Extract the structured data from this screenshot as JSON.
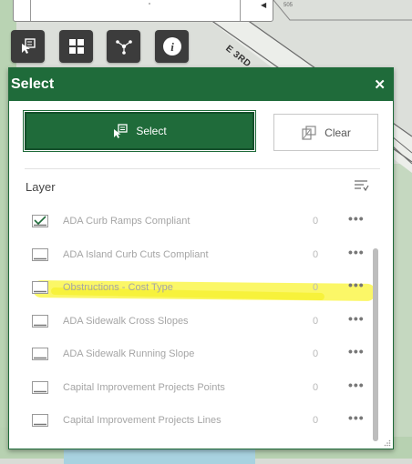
{
  "map": {
    "street_label": "E 3RD",
    "small_label": "505"
  },
  "toolbar": {
    "tools": [
      "select-tool",
      "basemap-gallery",
      "share",
      "info"
    ],
    "info_glyph": "i"
  },
  "panel": {
    "title": "Select",
    "close_label": "✕",
    "select_button_label": "Select",
    "clear_button_label": "Clear",
    "layer_header": "Layer",
    "layers": [
      {
        "name": "ADA Curb Ramps Compliant",
        "count": "0",
        "checked": true,
        "highlighted": true
      },
      {
        "name": "ADA Island Curb Cuts Compliant",
        "count": "0",
        "checked": false
      },
      {
        "name": "Obstructions - Cost Type",
        "count": "0",
        "checked": false
      },
      {
        "name": "ADA Sidewalk Cross Slopes",
        "count": "0",
        "checked": false
      },
      {
        "name": "ADA Sidewalk Running Slope",
        "count": "0",
        "checked": false
      },
      {
        "name": "Capital Improvement Projects Points",
        "count": "0",
        "checked": false
      },
      {
        "name": "Capital Improvement Projects Lines",
        "count": "0",
        "checked": false
      }
    ],
    "more_label": "•••"
  },
  "colors": {
    "accent": "#1f6b3a",
    "highlight": "#fbf65a"
  }
}
